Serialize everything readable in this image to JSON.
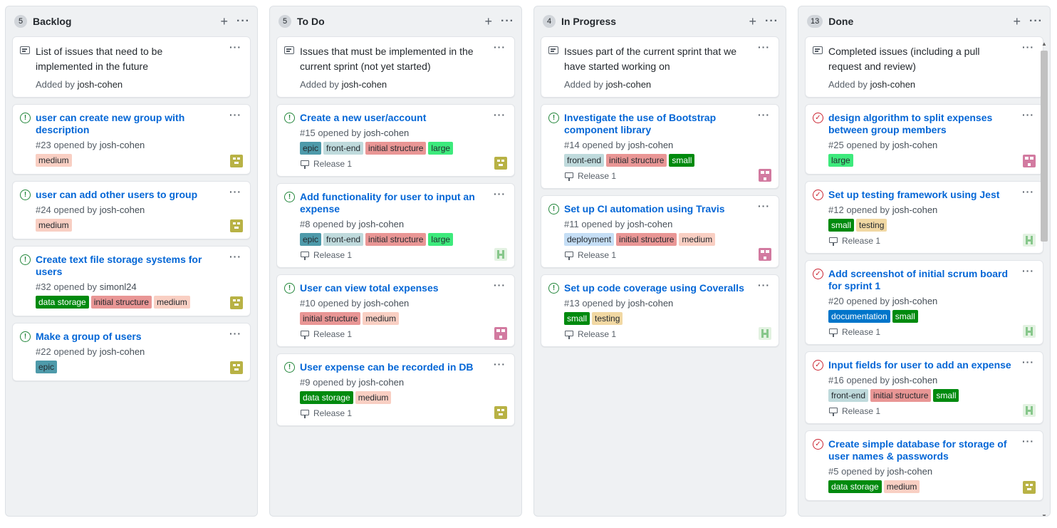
{
  "icons": {
    "add": "plus-icon",
    "menu": "kebab-icon",
    "note": "note-icon",
    "open_issue": "issue-opened-icon",
    "closed_issue": "issue-closed-icon",
    "milestone": "milestone-icon"
  },
  "colors": {
    "link": "#0366d6",
    "open": "#22863a",
    "closed": "#cb2431"
  },
  "columns": [
    {
      "id": "backlog",
      "count": "5",
      "title": "Backlog",
      "note": {
        "text": "List of issues that need to be implemented in the future",
        "added_prefix": "Added by",
        "author": "josh-cohen"
      },
      "cards": [
        {
          "title": "user can create new group with description",
          "number": "#23",
          "opened": "opened by",
          "author": "josh-cohen",
          "state": "open",
          "labels": [
            {
              "name": "medium",
              "bg": "#f9cfc3",
              "fg": "#24292e"
            }
          ],
          "milestone": "",
          "avatar": "olive"
        },
        {
          "title": "user can add other users to group",
          "number": "#24",
          "opened": "opened by",
          "author": "josh-cohen",
          "state": "open",
          "labels": [
            {
              "name": "medium",
              "bg": "#f9cfc3",
              "fg": "#24292e"
            }
          ],
          "milestone": "",
          "avatar": "olive"
        },
        {
          "title": "Create text file storage systems for users",
          "number": "#32",
          "opened": "opened by",
          "author": "simonl24",
          "state": "open",
          "labels": [
            {
              "name": "data storage",
              "bg": "#008a0e",
              "fg": "#ffffff"
            },
            {
              "name": "initial structure",
              "bg": "#e99695",
              "fg": "#24292e"
            },
            {
              "name": "medium",
              "bg": "#f9cfc3",
              "fg": "#24292e"
            }
          ],
          "milestone": "",
          "avatar": "olive"
        },
        {
          "title": "Make a group of users",
          "number": "#22",
          "opened": "opened by",
          "author": "josh-cohen",
          "state": "open",
          "labels": [
            {
              "name": "epic",
              "bg": "#4e9aaa",
              "fg": "#24292e"
            }
          ],
          "milestone": "",
          "avatar": "olive"
        }
      ]
    },
    {
      "id": "todo",
      "count": "5",
      "title": "To Do",
      "note": {
        "text": "Issues that must be implemented in the current sprint (not yet started)",
        "added_prefix": "Added by",
        "author": "josh-cohen"
      },
      "cards": [
        {
          "title": "Create a new user/account",
          "number": "#15",
          "opened": "opened by",
          "author": "josh-cohen",
          "state": "open",
          "labels": [
            {
              "name": "epic",
              "bg": "#4e9aaa",
              "fg": "#24292e"
            },
            {
              "name": "front-end",
              "bg": "#bfdadc",
              "fg": "#24292e"
            },
            {
              "name": "initial structure",
              "bg": "#e99695",
              "fg": "#24292e"
            },
            {
              "name": "large",
              "bg": "#3dea7c",
              "fg": "#24292e"
            }
          ],
          "milestone": "Release 1",
          "avatar": "olive"
        },
        {
          "title": "Add functionality for user to input an expense",
          "number": "#8",
          "opened": "opened by",
          "author": "josh-cohen",
          "state": "open",
          "labels": [
            {
              "name": "epic",
              "bg": "#4e9aaa",
              "fg": "#24292e"
            },
            {
              "name": "front-end",
              "bg": "#bfdadc",
              "fg": "#24292e"
            },
            {
              "name": "initial structure",
              "bg": "#e99695",
              "fg": "#24292e"
            },
            {
              "name": "large",
              "bg": "#3dea7c",
              "fg": "#24292e"
            }
          ],
          "milestone": "Release 1",
          "avatar": "green"
        },
        {
          "title": "User can view total expenses",
          "number": "#10",
          "opened": "opened by",
          "author": "josh-cohen",
          "state": "open",
          "labels": [
            {
              "name": "initial structure",
              "bg": "#e99695",
              "fg": "#24292e"
            },
            {
              "name": "medium",
              "bg": "#f9cfc3",
              "fg": "#24292e"
            }
          ],
          "milestone": "Release 1",
          "avatar": "pink"
        },
        {
          "title": "User expense can be recorded in DB",
          "number": "#9",
          "opened": "opened by",
          "author": "josh-cohen",
          "state": "open",
          "labels": [
            {
              "name": "data storage",
              "bg": "#008a0e",
              "fg": "#ffffff"
            },
            {
              "name": "medium",
              "bg": "#f9cfc3",
              "fg": "#24292e"
            }
          ],
          "milestone": "Release 1",
          "avatar": "olive"
        }
      ]
    },
    {
      "id": "in-progress",
      "count": "4",
      "title": "In Progress",
      "note": {
        "text": "Issues part of the current sprint that we have started working on",
        "added_prefix": "Added by",
        "author": "josh-cohen"
      },
      "cards": [
        {
          "title": "Investigate the use of Bootstrap component library",
          "number": "#14",
          "opened": "opened by",
          "author": "josh-cohen",
          "state": "open",
          "labels": [
            {
              "name": "front-end",
              "bg": "#bfdadc",
              "fg": "#24292e"
            },
            {
              "name": "initial structure",
              "bg": "#e99695",
              "fg": "#24292e"
            },
            {
              "name": "small",
              "bg": "#008a0e",
              "fg": "#ffffff"
            }
          ],
          "milestone": "Release 1",
          "avatar": "pink"
        },
        {
          "title": "Set up CI automation using Travis",
          "number": "#11",
          "opened": "opened by",
          "author": "josh-cohen",
          "state": "open",
          "labels": [
            {
              "name": "deployment",
              "bg": "#c5def5",
              "fg": "#24292e"
            },
            {
              "name": "initial structure",
              "bg": "#e99695",
              "fg": "#24292e"
            },
            {
              "name": "medium",
              "bg": "#f9cfc3",
              "fg": "#24292e"
            }
          ],
          "milestone": "Release 1",
          "avatar": "pink"
        },
        {
          "title": "Set up code coverage using Coveralls",
          "number": "#13",
          "opened": "opened by",
          "author": "josh-cohen",
          "state": "open",
          "labels": [
            {
              "name": "small",
              "bg": "#008a0e",
              "fg": "#ffffff"
            },
            {
              "name": "testing",
              "bg": "#f1d8a3",
              "fg": "#24292e"
            }
          ],
          "milestone": "Release 1",
          "avatar": "green"
        }
      ]
    },
    {
      "id": "done",
      "count": "13",
      "title": "Done",
      "note": {
        "text": "Completed issues (including a pull request and review)",
        "added_prefix": "Added by",
        "author": "josh-cohen"
      },
      "cards": [
        {
          "title": "design algorithm to split expenses between group members",
          "number": "#25",
          "opened": "opened by",
          "author": "josh-cohen",
          "state": "closed",
          "labels": [
            {
              "name": "large",
              "bg": "#3dea7c",
              "fg": "#24292e"
            }
          ],
          "milestone": "",
          "avatar": "pink"
        },
        {
          "title": "Set up testing framework using Jest",
          "number": "#12",
          "opened": "opened by",
          "author": "josh-cohen",
          "state": "closed",
          "labels": [
            {
              "name": "small",
              "bg": "#008a0e",
              "fg": "#ffffff"
            },
            {
              "name": "testing",
              "bg": "#f1d8a3",
              "fg": "#24292e"
            }
          ],
          "milestone": "Release 1",
          "avatar": "green"
        },
        {
          "title": "Add screenshot of initial scrum board for sprint 1",
          "number": "#20",
          "opened": "opened by",
          "author": "josh-cohen",
          "state": "closed",
          "labels": [
            {
              "name": "documentation",
              "bg": "#0075ca",
              "fg": "#ffffff"
            },
            {
              "name": "small",
              "bg": "#008a0e",
              "fg": "#ffffff"
            }
          ],
          "milestone": "Release 1",
          "avatar": "green"
        },
        {
          "title": "Input fields for user to add an expense",
          "number": "#16",
          "opened": "opened by",
          "author": "josh-cohen",
          "state": "closed",
          "labels": [
            {
              "name": "front-end",
              "bg": "#bfdadc",
              "fg": "#24292e"
            },
            {
              "name": "initial structure",
              "bg": "#e99695",
              "fg": "#24292e"
            },
            {
              "name": "small",
              "bg": "#008a0e",
              "fg": "#ffffff"
            }
          ],
          "milestone": "Release 1",
          "avatar": "green"
        },
        {
          "title": "Create simple database for storage of user names & passwords",
          "number": "#5",
          "opened": "opened by",
          "author": "josh-cohen",
          "state": "closed",
          "labels": [
            {
              "name": "data storage",
              "bg": "#008a0e",
              "fg": "#ffffff"
            },
            {
              "name": "medium",
              "bg": "#f9cfc3",
              "fg": "#24292e"
            }
          ],
          "milestone": "",
          "avatar": "olive"
        }
      ]
    }
  ]
}
